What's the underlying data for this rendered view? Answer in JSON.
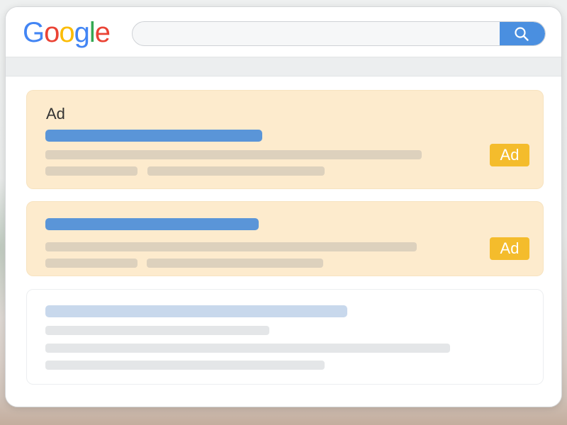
{
  "header": {
    "logo_letters": [
      "G",
      "o",
      "o",
      "g",
      "l",
      "e"
    ],
    "logo_colors": [
      "#4285F4",
      "#EA4335",
      "#FBBC05",
      "#4285F4",
      "#34A853",
      "#EA4335"
    ],
    "search": {
      "value": "",
      "placeholder": ""
    },
    "search_button_icon": "search-icon"
  },
  "results": {
    "ad_results": [
      {
        "label": "Ad",
        "badge": "Ad"
      },
      {
        "badge": "Ad"
      }
    ]
  },
  "colors": {
    "ad_background": "#fdebcd",
    "ad_badge": "#f4bc2c",
    "link_placeholder": "#5a95d8",
    "search_button": "#4a8fe0"
  }
}
